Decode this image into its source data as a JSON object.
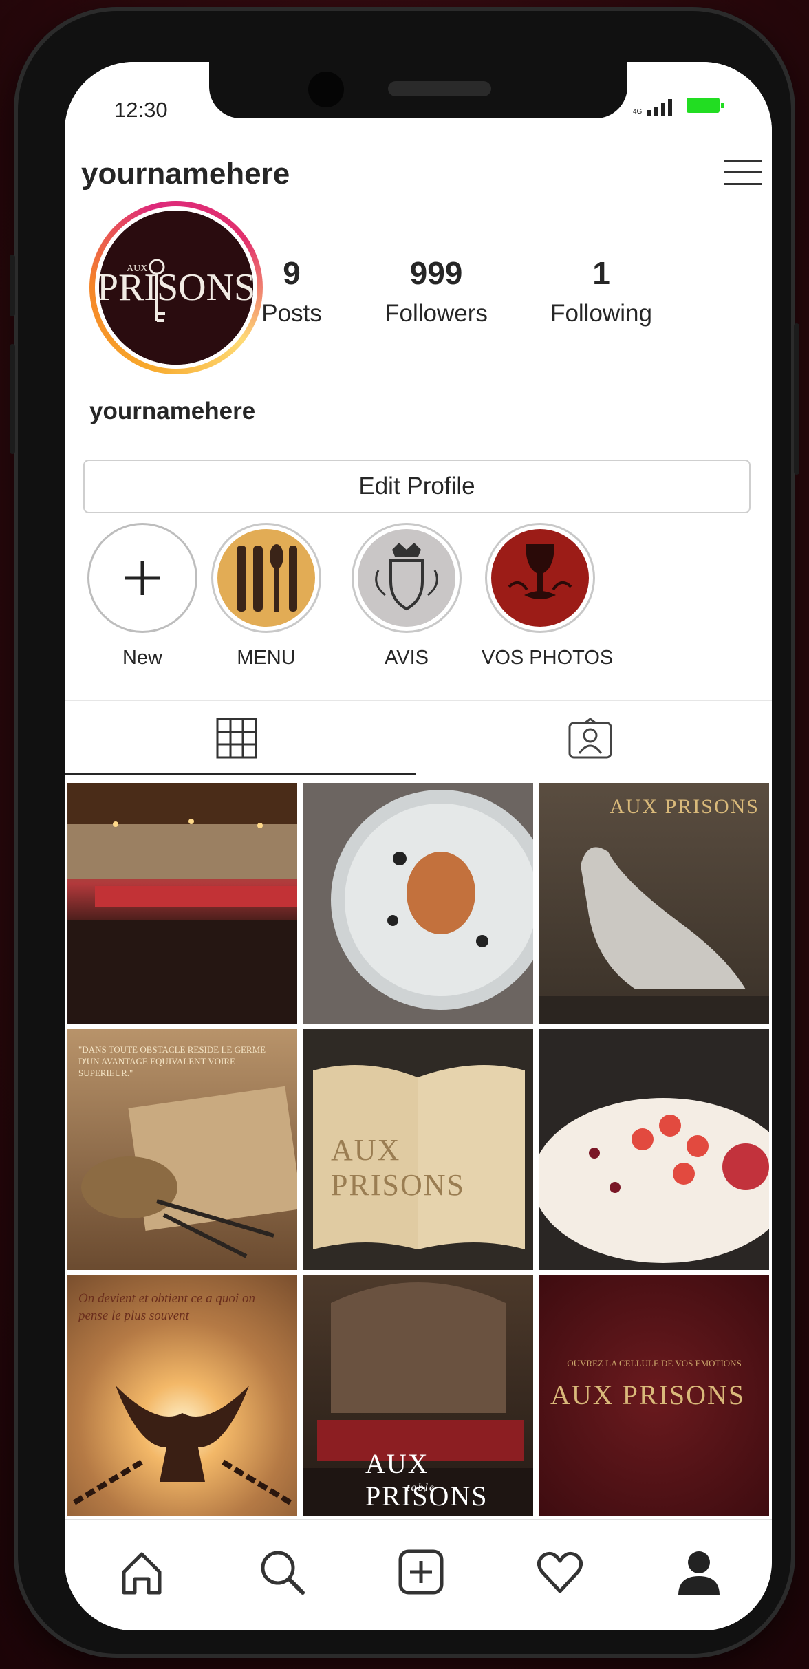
{
  "status_bar": {
    "time": "12:30",
    "network": "4G"
  },
  "header": {
    "username": "yournamehere"
  },
  "profile": {
    "avatar_text": "PRISONS",
    "avatar_small": "AUX",
    "name": "yournamehere",
    "stats": [
      {
        "value": "9",
        "label": "Posts"
      },
      {
        "value": "999",
        "label": "Followers"
      },
      {
        "value": "1",
        "label": "Following"
      }
    ],
    "edit_label": "Edit Profile"
  },
  "highlights": [
    {
      "label": "New",
      "icon": "plus-icon"
    },
    {
      "label": "MENU",
      "icon": "cutlery-icon"
    },
    {
      "label": "AVIS",
      "icon": "crest-icon"
    },
    {
      "label": "VOS PHOTOS",
      "icon": "chalice-icon"
    }
  ],
  "tabs": [
    {
      "name": "grid",
      "icon": "grid-icon"
    },
    {
      "name": "tagged",
      "icon": "tagged-person-icon"
    }
  ],
  "posts": [
    {
      "caption": ""
    },
    {
      "caption": ""
    },
    {
      "caption": "",
      "brand": "AUX PRISONS"
    },
    {
      "caption": "\"DANS TOUTE OBSTACLE RESIDE LE GERME D'UN AVANTAGE EQUIVALENT VOIRE SUPERIEUR.\""
    },
    {
      "caption": "",
      "brand": "AUX PRISONS"
    },
    {
      "caption": ""
    },
    {
      "caption": "On devient et obtient ce a quoi on pense le plus souvent"
    },
    {
      "caption": "",
      "brand": "AUX PRISONS",
      "sub": "table"
    },
    {
      "caption": "OUVREZ LA CELLULE DE VOS EMOTIONS",
      "brand": "AUX PRISONS"
    }
  ],
  "bottom_nav": [
    {
      "name": "home",
      "icon": "home-icon"
    },
    {
      "name": "search",
      "icon": "search-icon"
    },
    {
      "name": "new-post",
      "icon": "add-post-icon"
    },
    {
      "name": "activity",
      "icon": "heart-icon"
    },
    {
      "name": "profile",
      "icon": "profile-icon"
    }
  ],
  "colors": {
    "brand_dark": "#2a0c0f",
    "gold": "#d9b97a",
    "battery": "#22dd22"
  }
}
